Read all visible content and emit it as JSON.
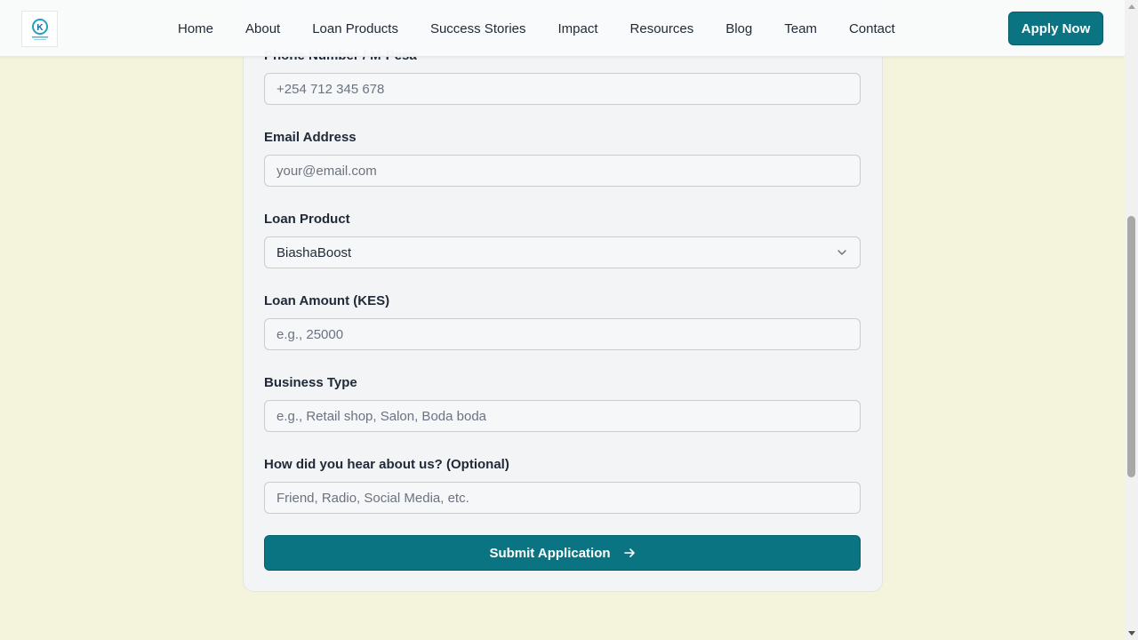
{
  "header": {
    "logo_icon": "company-logo",
    "nav": [
      "Home",
      "About",
      "Loan Products",
      "Success Stories",
      "Impact",
      "Resources",
      "Blog",
      "Team",
      "Contact"
    ],
    "apply_label": "Apply Now"
  },
  "form": {
    "phone": {
      "label": "Phone Number / M-Pesa",
      "placeholder": "+254 712 345 678"
    },
    "email": {
      "label": "Email Address",
      "placeholder": "your@email.com"
    },
    "loan_product": {
      "label": "Loan Product",
      "value": "BiashaBoost"
    },
    "loan_amount": {
      "label": "Loan Amount (KES)",
      "placeholder": "e.g., 25000"
    },
    "business_type": {
      "label": "Business Type",
      "placeholder": "e.g., Retail shop, Salon, Boda boda"
    },
    "referral": {
      "label": "How did you hear about us? (Optional)",
      "placeholder": "Friend, Radio, Social Media, etc."
    },
    "submit_label": "Submit Application"
  },
  "colors": {
    "primary": "#0b7482",
    "page_bg": "#f4f4dd",
    "card_bg": "#f3f4f6"
  }
}
